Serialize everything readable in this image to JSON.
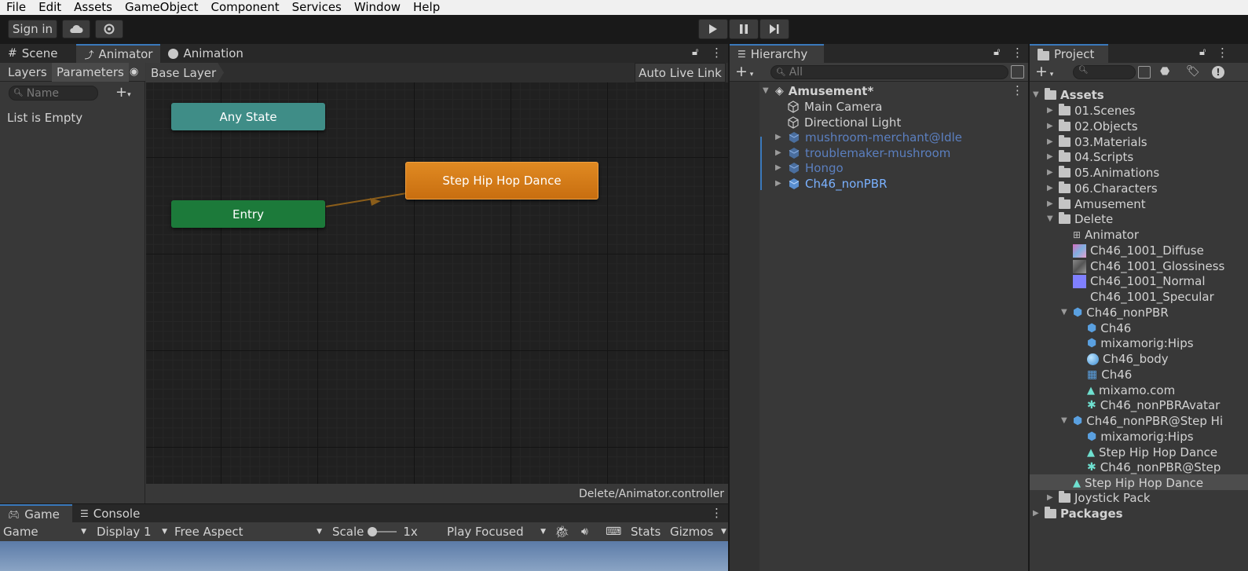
{
  "menu": [
    "File",
    "Edit",
    "Assets",
    "GameObject",
    "Component",
    "Services",
    "Window",
    "Help"
  ],
  "toolbar": {
    "sign_in": "Sign in"
  },
  "animator": {
    "tabs": [
      "Scene",
      "Animator",
      "Animation"
    ],
    "subtabs": [
      "Layers",
      "Parameters"
    ],
    "breadcrumb": "Base Layer",
    "auto_live_link": "Auto Live Link",
    "search_placeholder": "Name",
    "list_empty": "List is Empty",
    "nodes": {
      "any_state": "Any State",
      "entry": "Entry",
      "state": "Step Hip Hop Dance"
    },
    "status_path": "Delete/Animator.controller",
    "colors": {
      "any_state": "#3f8d87",
      "entry": "#1c7a3a",
      "state": "#d07818",
      "grid_bg": "#202020"
    }
  },
  "hierarchy": {
    "title": "Hierarchy",
    "search_placeholder": "All",
    "scene": "Amusement*",
    "items": [
      {
        "label": "Main Camera",
        "style": "normal"
      },
      {
        "label": "Directional Light",
        "style": "normal"
      },
      {
        "label": "mushroom-merchant@Idle",
        "style": "prefab-dim"
      },
      {
        "label": "troublemaker-mushroom",
        "style": "prefab-dim"
      },
      {
        "label": "Hongo",
        "style": "prefab-dim"
      },
      {
        "label": "Ch46_nonPBR",
        "style": "prefab"
      }
    ]
  },
  "project": {
    "title": "Project",
    "root": "Assets",
    "folders": [
      "01.Scenes",
      "02.Objects",
      "03.Materials",
      "04.Scripts",
      "05.Animations",
      "06.Characters",
      "Amusement"
    ],
    "delete_folder": "Delete",
    "delete_items": [
      "Animator",
      "Ch46_1001_Diffuse",
      "Ch46_1001_Glossiness",
      "Ch46_1001_Normal",
      "Ch46_1001_Specular"
    ],
    "nonpbr": "Ch46_nonPBR",
    "nonpbr_children": [
      "Ch46",
      "mixamorig:Hips",
      "Ch46_body",
      "Ch46",
      "mixamo.com",
      "Ch46_nonPBRAvatar"
    ],
    "nonpbr_step": "Ch46_nonPBR@Step Hi",
    "step_children": [
      "mixamorig:Hips",
      "Step Hip Hop Dance",
      "Ch46_nonPBR@Step"
    ],
    "selected": "Step Hip Hop Dance",
    "joystick": "Joystick Pack",
    "packages": "Packages"
  },
  "game": {
    "tabs": [
      "Game",
      "Console"
    ],
    "view": "Game",
    "display": "Display 1",
    "aspect": "Free Aspect",
    "scale_label": "Scale",
    "scale_value": "1x",
    "play_mode": "Play Focused",
    "stats": "Stats",
    "gizmos": "Gizmos"
  }
}
